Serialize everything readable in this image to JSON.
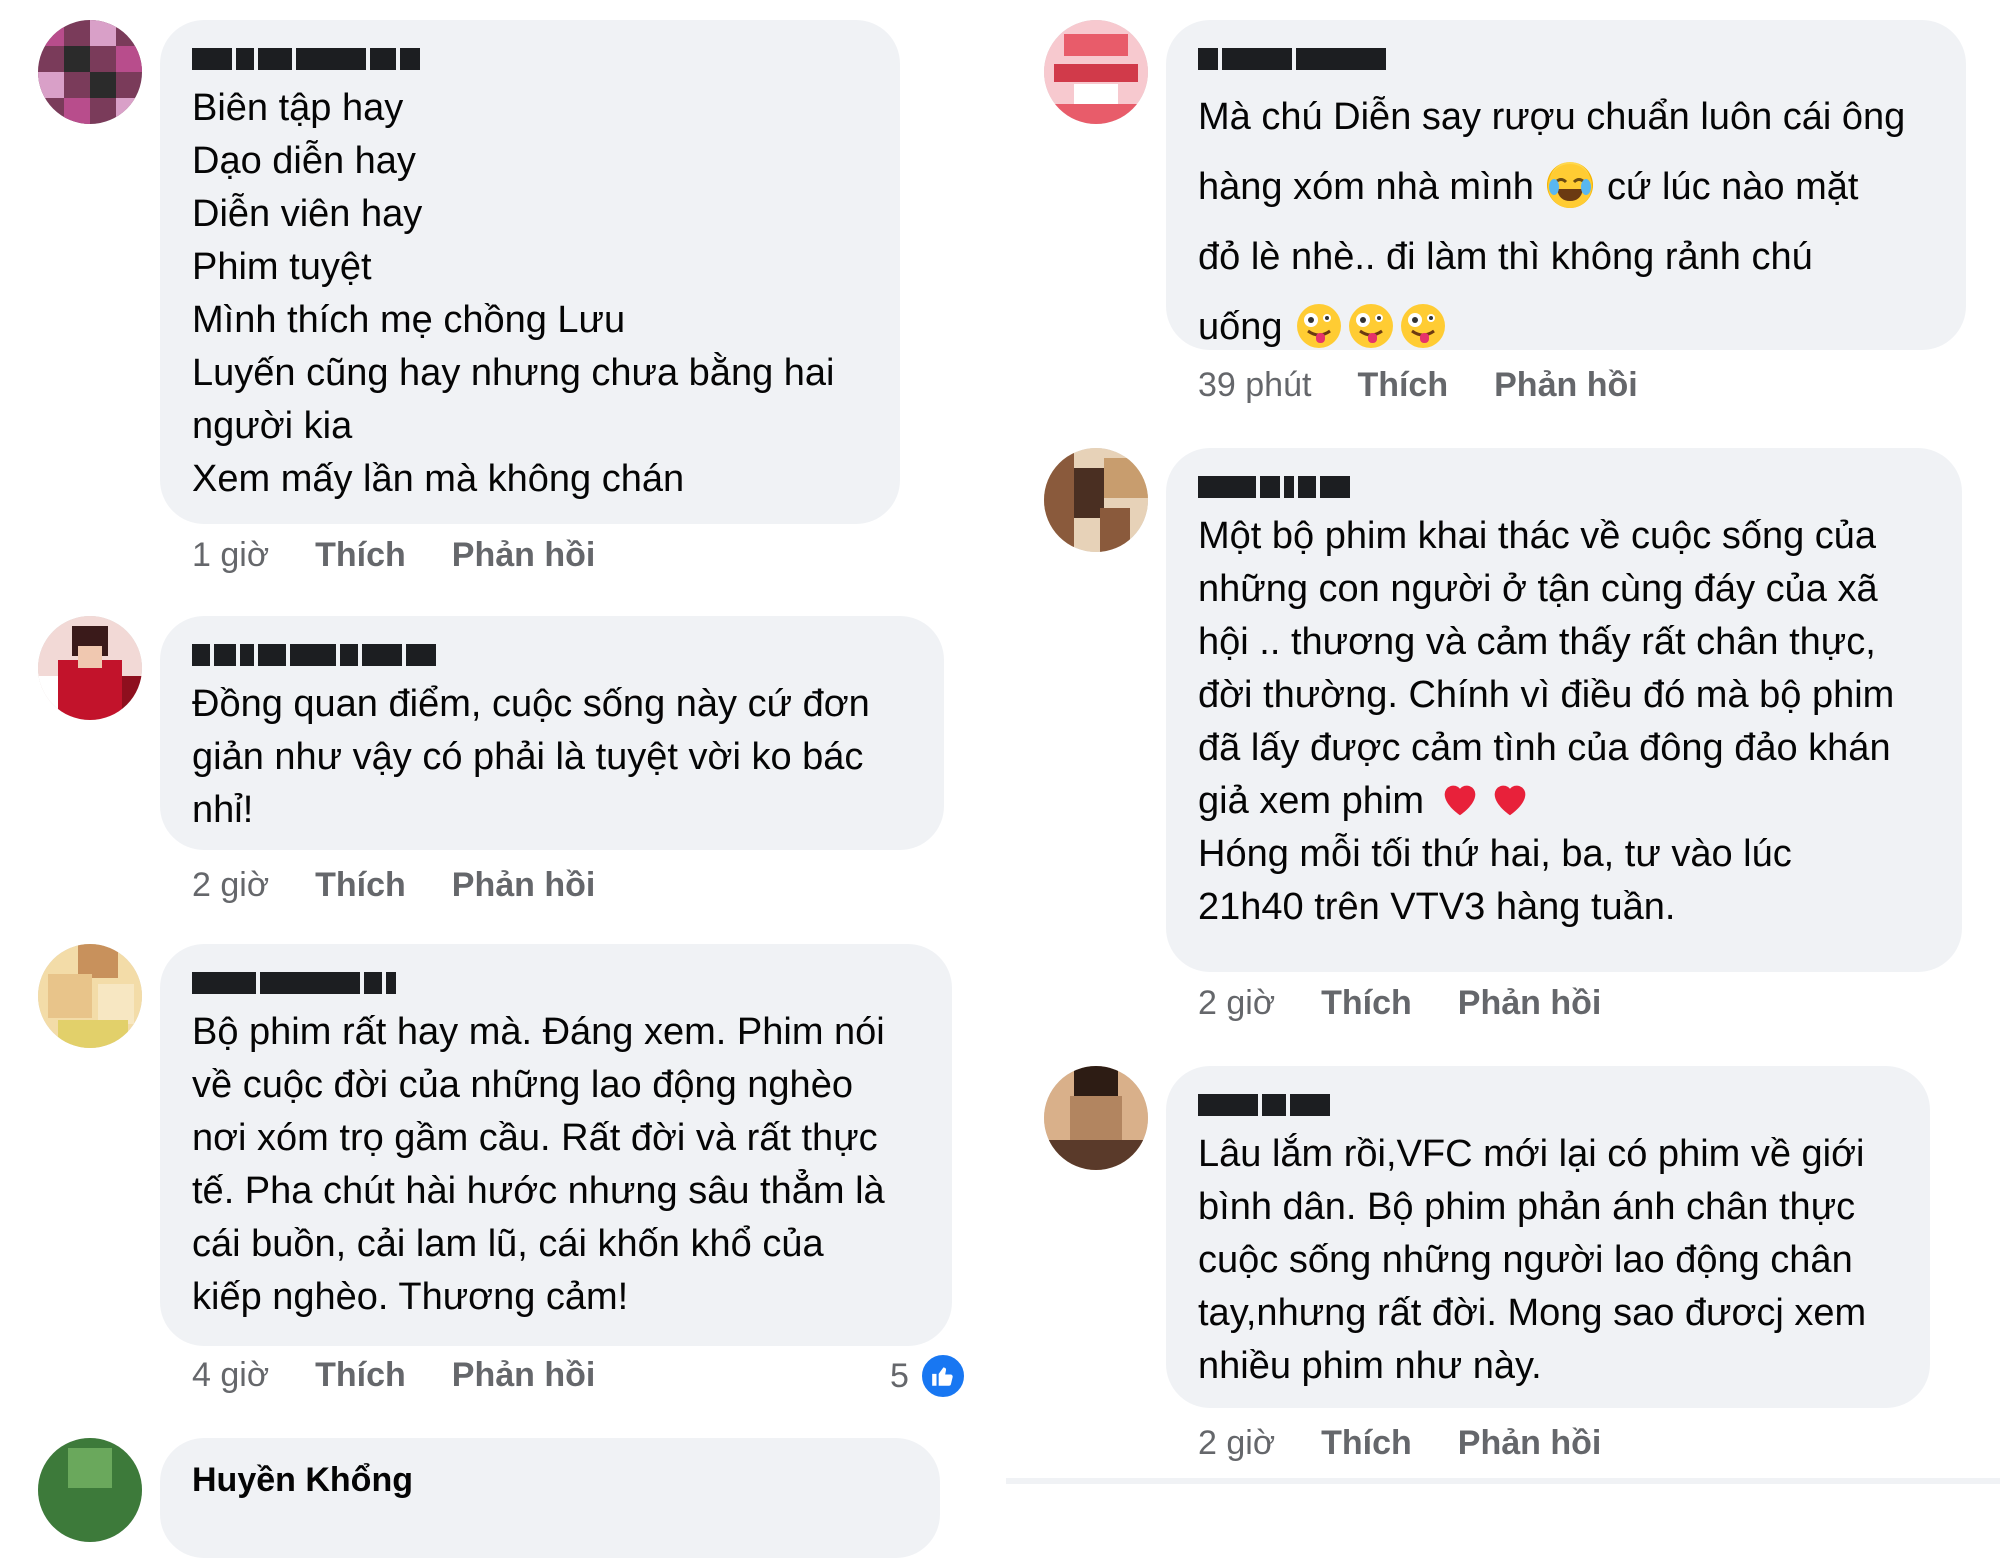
{
  "left_column": [
    {
      "avatar_colors": [
        "#7a3b5a",
        "#b84d8c",
        "#2b2b2b",
        "#d9a0c8"
      ],
      "body": "Biên tập hay\nDạo diễn hay\nDiễn viên hay\nPhim tuyệt\nMình thích mẹ chồng Lưu\nLuyến cũng hay nhưng chưa bằng hai\nngười kia\nXem mấy lần mà không chán",
      "time": "1 giờ",
      "like_label": "Thích",
      "reply_label": "Phản hồi"
    },
    {
      "avatar_colors": [
        "#c2132b",
        "#f2d9d6",
        "#8e0f1e",
        "#ffffff"
      ],
      "body": "Đồng quan điểm, cuộc sống này cứ đơn\ngiản như vậy có phải là tuyệt vời ko bác\nnhỉ!",
      "time": "2 giờ",
      "like_label": "Thích",
      "reply_label": "Phản hồi"
    },
    {
      "avatar_colors": [
        "#e8c48a",
        "#f3dca8",
        "#c8915c",
        "#f7e7c2"
      ],
      "body": "Bộ phim rất hay mà. Đáng xem. Phim nói\nvề cuộc đời của những lao động nghèo\nnơi xóm trọ gầm cầu. Rất đời và rất thực\ntế. Pha chút hài hước nhưng sâu thẳm là\ncái buồn, cải lam lũ, cái khốn khổ của\nkiếp nghèo. Thương cảm!",
      "time": "4 giờ",
      "like_label": "Thích",
      "reply_label": "Phản hồi",
      "reaction_count": "5"
    },
    {
      "avatar_colors": [
        "#3d7a3a",
        "#6aa85c"
      ],
      "name": "Huyền Khổng"
    }
  ],
  "right_column": [
    {
      "avatar_colors": [
        "#e85c6a",
        "#f7c9cf",
        "#ffffff",
        "#d13a4a"
      ],
      "body_parts": [
        "Mà chú Diễn say rượu chuẩn luôn cái ông\nhàng xóm nhà mình ",
        " cứ lúc nào mặt\nđỏ lè nhè.. đi làm thì không rảnh chú\nuống "
      ],
      "emoji_1": "face-with-tears-of-joy",
      "emoji_2": "zany-face",
      "time": "39 phút",
      "like_label": "Thích",
      "reply_label": "Phản hồi"
    },
    {
      "avatar_colors": [
        "#8a5a3c",
        "#e7d2b8",
        "#4a2f22",
        "#c89d6e"
      ],
      "body_before_hearts": "Một bộ phim khai thác về cuộc sống của\nnhững con người ở tận cùng đáy của xã\nhội .. thương và cảm thấy rất chân thực,\nđời thường. Chính vì điều đó mà bộ phim\nđã lấy được cảm tình của đông đảo khán\ngiả xem phim ",
      "body_after_hearts": "Hóng mỗi tối thứ hai, ba, tư vào lúc\n21h40 trên VTV3 hàng tuần.",
      "emoji": "red-heart",
      "time": "2 giờ",
      "like_label": "Thích",
      "reply_label": "Phản hồi"
    },
    {
      "avatar_colors": [
        "#5a3a2a",
        "#d9b08a",
        "#2d1c14",
        "#b28560"
      ],
      "body": "Lâu lắm rồi,VFC mới lại có phim về giới\nbình dân. Bộ phim phản ánh chân thực\ncuộc sống những người lao động chân\ntay,nhưng rất đời. Mong sao đươcj xem\nnhiều phim như này.",
      "time": "2 giờ",
      "like_label": "Thích",
      "reply_label": "Phản hồi"
    }
  ]
}
